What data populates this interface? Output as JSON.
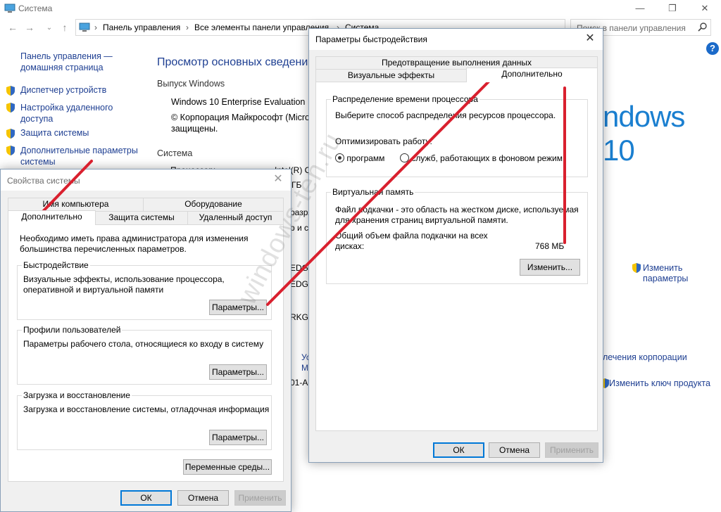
{
  "main": {
    "title": "Система",
    "window_controls": [
      "—",
      "❐",
      "✕"
    ],
    "breadcrumb": [
      "Панель управления",
      "Все элементы панели управления",
      "Система"
    ],
    "search_placeholder": "Поиск в панели управления",
    "help": "?",
    "sidebar": {
      "home": "Панель управления — домашняя страница",
      "items": [
        "Диспетчер устройств",
        "Настройка удаленного доступа",
        "Защита системы",
        "Дополнительные параметры системы"
      ]
    },
    "heading": "Просмотр основных сведений",
    "edition_label": "Выпуск Windows",
    "edition": "Windows 10 Enterprise Evaluation",
    "copyright": "© Корпорация Майкрософт (Micro",
    "copyright_2": "защищены.",
    "system_label": "Система",
    "logo": "ndows 10",
    "fragments": [
      "Процессор:",
      "Intel(R) C",
      "0 ГБ",
      "разря",
      "р и с",
      "EDGE",
      "EDGE",
      "RKGR",
      "Ус",
      "М",
      "01-A"
    ],
    "right_links": {
      "change_params_1": "Изменить",
      "change_params_2": "параметры",
      "license": "лечения корпорации",
      "product_key": "Изменить ключ продукта"
    }
  },
  "sysprops": {
    "title": "Свойства системы",
    "tabs_row1": [
      "Имя компьютера",
      "Оборудование"
    ],
    "tabs_row2": [
      "Дополнительно",
      "Защита системы",
      "Удаленный доступ"
    ],
    "admin_note": "Необходимо иметь права администратора для изменения большинства перечисленных параметров.",
    "performance": {
      "label": "Быстродействие",
      "desc": "Визуальные эффекты, использование процессора, оперативной и виртуальной памяти",
      "button": "Параметры..."
    },
    "profiles": {
      "label": "Профили пользователей",
      "desc": "Параметры рабочего стола, относящиеся ко входу в систему",
      "button": "Параметры..."
    },
    "startup": {
      "label": "Загрузка и восстановление",
      "desc": "Загрузка и восстановление системы, отладочная информация",
      "button": "Параметры..."
    },
    "env_button": "Переменные среды...",
    "ok": "ОК",
    "cancel": "Отмена",
    "apply": "Применить"
  },
  "perf": {
    "title": "Параметры быстродействия",
    "tab_top": "Предотвращение выполнения данных",
    "tab_visual": "Визуальные эффекты",
    "tab_advanced": "Дополнительно",
    "cpu": {
      "label": "Распределение времени процессора",
      "desc": "Выберите способ распределения ресурсов процессора.",
      "optimize": "Оптимизировать работу:",
      "opt_programs": "программ",
      "opt_services": "служб, работающих в фоновом режим",
      "selected": "программ"
    },
    "vm": {
      "label": "Виртуальная память",
      "desc_1": "Файл подкачки - это область на жестком диске, используемая",
      "desc_2": "для хранения страниц виртуальной памяти.",
      "total_1": "Общий объем файла подкачки на всех",
      "total_2": "дисках:",
      "total_value": "768 МБ",
      "button": "Изменить..."
    },
    "ok": "ОК",
    "cancel": "Отмена",
    "apply": "Применить"
  },
  "watermark": "windows-ten.ru",
  "colors": {
    "link": "#1e3f92",
    "annotation": "#d9202e",
    "accent": "#0078d7"
  }
}
